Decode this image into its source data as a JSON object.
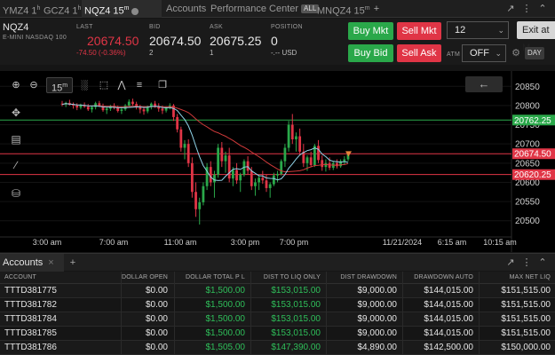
{
  "tabs": [
    {
      "label": "YMZ4 1",
      "sup": "h",
      "x": 0,
      "w": 44
    },
    {
      "label": "GCZ4 1",
      "sup": "h",
      "x": 46,
      "w": 44
    },
    {
      "label": "NQZ4 15",
      "sup": "m",
      "x": 92,
      "w": 90,
      "active": true
    },
    {
      "label": "Accounts",
      "x": 184,
      "w": 48
    },
    {
      "label": "Performance Center",
      "badge": "ALL",
      "x": 234,
      "w": 118
    },
    {
      "label": "MNQZ4 15",
      "sup": "m",
      "x": 354,
      "w": 60
    }
  ],
  "quote": {
    "symbol": "NQZ4",
    "description": "E-MINI NASDAQ 100",
    "last_label": "LAST",
    "last": "20674.50",
    "last_change": "-74.50 (-0.36%)",
    "bid_label": "BID",
    "bid": "20674.50",
    "bid_size": "2",
    "ask_label": "ASK",
    "ask": "20675.25",
    "ask_size": "1",
    "position_label": "POSITION",
    "position": "0",
    "position_pnl": "-.-- USD"
  },
  "order": {
    "buy_mkt": "Buy Mkt",
    "sell_mkt": "Sell Mkt",
    "buy_bid": "Buy Bid",
    "sell_ask": "Sell Ask",
    "qty": "12",
    "exit": "Exit at M",
    "atm_label": "ATM",
    "atm_value": "OFF",
    "tif": "DAY"
  },
  "chart": {
    "interval_label": "15",
    "interval_sup": "m"
  },
  "chart_data": {
    "type": "candlestick",
    "ylim": [
      20460,
      20890
    ],
    "y_ticks": [
      20500,
      20550,
      20600,
      20650,
      20700,
      20750,
      20800,
      20850
    ],
    "x_tick_labels": [
      "3:00 am",
      "7:00 am",
      "11:00 am",
      "3:00 pm",
      "7:00 pm",
      "11/21/2024",
      "6:15 am",
      "10:15 am"
    ],
    "price_labels": [
      {
        "value": 20762.25,
        "text": "20762.25",
        "color": "#2aa84a"
      },
      {
        "value": 20674.5,
        "text": "20674.50",
        "color": "#e03546"
      },
      {
        "value": 20620.25,
        "text": "20620.25",
        "color": "#e03546"
      }
    ],
    "hlines": [
      {
        "value": 20762.25,
        "color": "#2aa84a"
      },
      {
        "value": 20674.5,
        "color": "#e03546"
      },
      {
        "value": 20620.25,
        "color": "#e03546"
      }
    ],
    "candles": [
      [
        20805,
        20812,
        20798,
        20803
      ],
      [
        20803,
        20810,
        20796,
        20807
      ],
      [
        20807,
        20815,
        20800,
        20802
      ],
      [
        20802,
        20808,
        20792,
        20800
      ],
      [
        20800,
        20806,
        20788,
        20795
      ],
      [
        20795,
        20805,
        20790,
        20800
      ],
      [
        20800,
        20808,
        20794,
        20797
      ],
      [
        20797,
        20804,
        20786,
        20790
      ],
      [
        20790,
        20800,
        20782,
        20796
      ],
      [
        20796,
        20810,
        20790,
        20806
      ],
      [
        20806,
        20812,
        20796,
        20798
      ],
      [
        20798,
        20805,
        20784,
        20788
      ],
      [
        20788,
        20798,
        20778,
        20792
      ],
      [
        20792,
        20802,
        20786,
        20799
      ],
      [
        20799,
        20806,
        20790,
        20794
      ],
      [
        20794,
        20800,
        20782,
        20786
      ],
      [
        20786,
        20796,
        20778,
        20790
      ],
      [
        20790,
        20804,
        20786,
        20800
      ],
      [
        20800,
        20816,
        20796,
        20810
      ],
      [
        20810,
        20818,
        20800,
        20804
      ],
      [
        20804,
        20810,
        20790,
        20795
      ],
      [
        20795,
        20802,
        20780,
        20790
      ],
      [
        20790,
        20798,
        20776,
        20785
      ],
      [
        20785,
        20800,
        20780,
        20798
      ],
      [
        20798,
        20808,
        20790,
        20805
      ],
      [
        20805,
        20812,
        20794,
        20798
      ],
      [
        20798,
        20806,
        20784,
        20792
      ],
      [
        20792,
        20800,
        20778,
        20787
      ],
      [
        20787,
        20798,
        20782,
        20796
      ],
      [
        20796,
        20806,
        20790,
        20800
      ],
      [
        20800,
        20804,
        20760,
        20770
      ],
      [
        20770,
        20778,
        20730,
        20738
      ],
      [
        20738,
        20745,
        20680,
        20690
      ],
      [
        20690,
        20710,
        20660,
        20700
      ],
      [
        20700,
        20712,
        20640,
        20650
      ],
      [
        20650,
        20665,
        20560,
        20575
      ],
      [
        20575,
        20600,
        20510,
        20530
      ],
      [
        20530,
        20560,
        20490,
        20548
      ],
      [
        20548,
        20600,
        20540,
        20590
      ],
      [
        20590,
        20650,
        20580,
        20640
      ],
      [
        20640,
        20655,
        20590,
        20600
      ],
      [
        20600,
        20630,
        20560,
        20620
      ],
      [
        20620,
        20700,
        20612,
        20690
      ],
      [
        20690,
        20705,
        20640,
        20655
      ],
      [
        20655,
        20680,
        20625,
        20670
      ],
      [
        20670,
        20690,
        20600,
        20610
      ],
      [
        20610,
        20640,
        20590,
        20632
      ],
      [
        20632,
        20650,
        20596,
        20605
      ],
      [
        20605,
        20625,
        20575,
        20620
      ],
      [
        20620,
        20660,
        20615,
        20655
      ],
      [
        20655,
        20668,
        20620,
        20630
      ],
      [
        20630,
        20640,
        20580,
        20590
      ],
      [
        20590,
        20610,
        20565,
        20600
      ],
      [
        20600,
        20620,
        20580,
        20612
      ],
      [
        20612,
        20630,
        20596,
        20605
      ],
      [
        20605,
        20620,
        20575,
        20585
      ],
      [
        20585,
        20600,
        20560,
        20595
      ],
      [
        20595,
        20625,
        20590,
        20618
      ],
      [
        20618,
        20630,
        20600,
        20622
      ],
      [
        20622,
        20660,
        20618,
        20655
      ],
      [
        20655,
        20700,
        20640,
        20690
      ],
      [
        20690,
        20760,
        20680,
        20750
      ],
      [
        20750,
        20778,
        20700,
        20712
      ],
      [
        20712,
        20730,
        20680,
        20720
      ],
      [
        20720,
        20740,
        20670,
        20680
      ],
      [
        20680,
        20700,
        20640,
        20650
      ],
      [
        20650,
        20670,
        20630,
        20665
      ],
      [
        20665,
        20680,
        20640,
        20645
      ],
      [
        20645,
        20700,
        20640,
        20695
      ],
      [
        20695,
        20710,
        20650,
        20658
      ],
      [
        20658,
        20670,
        20630,
        20640
      ],
      [
        20640,
        20660,
        20628,
        20650
      ],
      [
        20650,
        20665,
        20632,
        20638
      ],
      [
        20638,
        20655,
        20632,
        20650
      ],
      [
        20650,
        20660,
        20636,
        20642
      ],
      [
        20642,
        20660,
        20638,
        20655
      ],
      [
        20655,
        20668,
        20645,
        20660
      ],
      [
        20660,
        20678,
        20655,
        20674
      ]
    ],
    "series": [
      {
        "values": []
      },
      {
        "values": []
      }
    ]
  },
  "accounts": {
    "tab_label": "Accounts",
    "columns": [
      "ACCOUNT",
      "DOLLAR OPEN",
      "DOLLAR TOTAL P L",
      "DIST TO LIQ ONLY",
      "DIST DRAWDOWN",
      "DRAWDOWN AUTO",
      "MAX NET LIQ"
    ],
    "rows": [
      [
        "TTTD381775",
        "$0.00",
        "$1,500.00",
        "$153,015.00",
        "$9,000.00",
        "$144,015.00",
        "$151,515.00"
      ],
      [
        "TTTD381782",
        "$0.00",
        "$1,500.00",
        "$153,015.00",
        "$9,000.00",
        "$144,015.00",
        "$151,515.00"
      ],
      [
        "TTTD381784",
        "$0.00",
        "$1,500.00",
        "$153,015.00",
        "$9,000.00",
        "$144,015.00",
        "$151,515.00"
      ],
      [
        "TTTD381785",
        "$0.00",
        "$1,500.00",
        "$153,015.00",
        "$9,000.00",
        "$144,015.00",
        "$151,515.00"
      ],
      [
        "TTTD381786",
        "$0.00",
        "$1,505.00",
        "$147,390.00",
        "$4,890.00",
        "$142,500.00",
        "$150,000.00"
      ]
    ]
  },
  "colors": {
    "up": "#2aa84a",
    "down": "#e03546",
    "ma_fast": "#8fd3e8",
    "ma_slow": "#d03a3a"
  }
}
